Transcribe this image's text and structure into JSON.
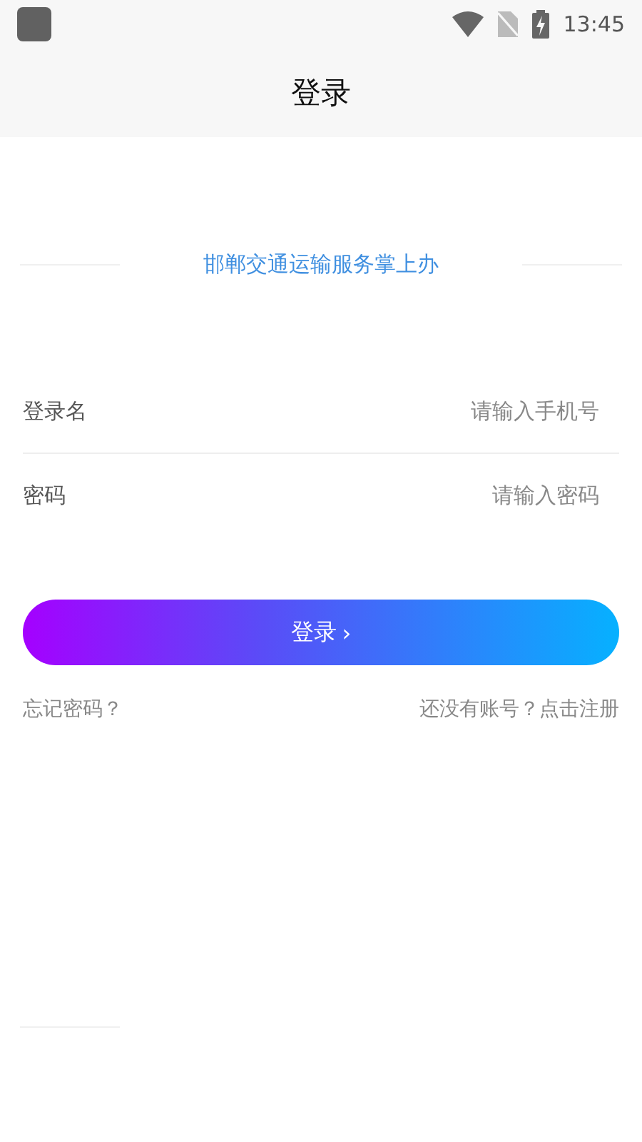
{
  "status_bar": {
    "time": "13:45"
  },
  "header": {
    "title": "登录"
  },
  "subtitle": "邯郸交通运输服务掌上办",
  "fields": [
    {
      "label": "登录名",
      "placeholder": "请输入手机号"
    },
    {
      "label": "密码",
      "placeholder": "请输入密码"
    }
  ],
  "login_button": {
    "label": "登录",
    "chevron": "›"
  },
  "links": {
    "forgot": "忘记密码？",
    "register": "还没有账号？点击注册"
  }
}
